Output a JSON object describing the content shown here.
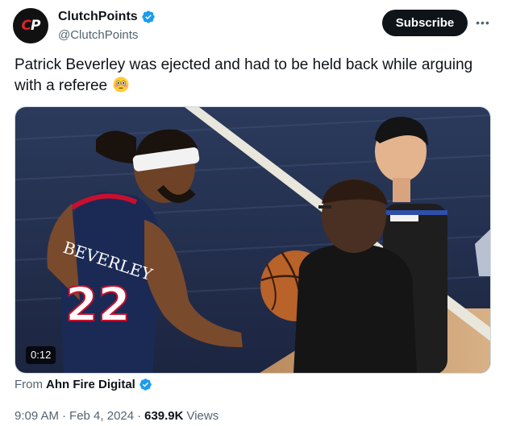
{
  "author": {
    "avatar_text_c": "C",
    "avatar_text_p": "P",
    "display_name": "ClutchPoints",
    "handle": "@ClutchPoints",
    "verified": true
  },
  "actions": {
    "subscribe_label": "Subscribe",
    "more_label": "•••"
  },
  "tweet": {
    "text": "Patrick Beverley was ejected and had to be held back while arguing with a referee"
  },
  "media": {
    "duration": "0:12",
    "jersey_name": "BEVERLEY",
    "jersey_number": "22"
  },
  "source": {
    "prefix": "From",
    "name": "Ahn Fire Digital",
    "verified": true
  },
  "meta": {
    "time": "9:09 AM",
    "date": "Feb 4, 2024",
    "views_count": "639.9K",
    "views_label": "Views",
    "separator": "·"
  },
  "colors": {
    "verified_blue": "#1d9bf0",
    "text_primary": "#0f1419",
    "text_secondary": "#536471",
    "brand_red": "#e8202a"
  }
}
